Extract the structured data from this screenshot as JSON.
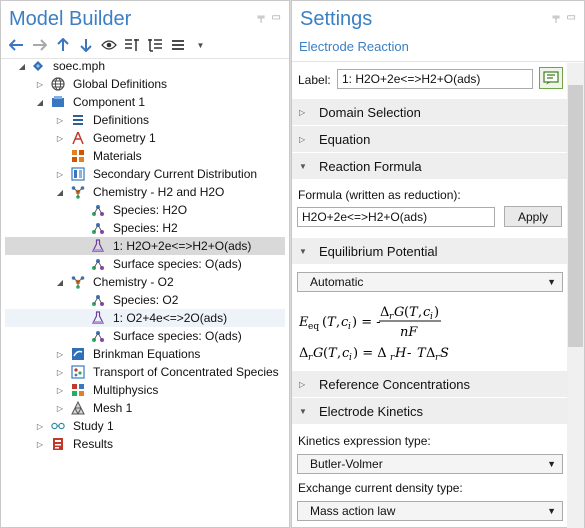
{
  "model_builder": {
    "title": "Model Builder",
    "tree": [
      {
        "label": "soec.mph",
        "icon": "model-file-icon",
        "arrow": "down"
      },
      {
        "label": "Global Definitions",
        "icon": "globe-icon",
        "arrow": "right"
      },
      {
        "label": "Component 1",
        "icon": "component-icon",
        "arrow": "down"
      },
      {
        "label": "Definitions",
        "icon": "definitions-list-icon",
        "arrow": "right"
      },
      {
        "label": "Geometry 1",
        "icon": "geometry-icon",
        "arrow": "right"
      },
      {
        "label": "Materials",
        "icon": "materials-icon",
        "arrow": ""
      },
      {
        "label": "Secondary Current Distribution",
        "icon": "current-distribution-icon",
        "arrow": "right"
      },
      {
        "label": "Chemistry - H2 and H2O",
        "icon": "chemistry-icon",
        "arrow": "down"
      },
      {
        "label": "Species: H2O",
        "icon": "species-icon",
        "arrow": ""
      },
      {
        "label": "Species: H2",
        "icon": "species-icon",
        "arrow": ""
      },
      {
        "label": "1: H2O+2e<=>H2+O(ads)",
        "icon": "flask-icon",
        "arrow": ""
      },
      {
        "label": "Surface species: O(ads)",
        "icon": "species-icon",
        "arrow": ""
      },
      {
        "label": "Chemistry - O2",
        "icon": "chemistry-icon",
        "arrow": "down"
      },
      {
        "label": "Species: O2",
        "icon": "species-icon",
        "arrow": ""
      },
      {
        "label": "1: O2+4e<=>2O(ads)",
        "icon": "flask-icon",
        "arrow": ""
      },
      {
        "label": "Surface species: O(ads)",
        "icon": "species-icon",
        "arrow": ""
      },
      {
        "label": "Brinkman Equations",
        "icon": "brinkman-icon",
        "arrow": "right"
      },
      {
        "label": "Transport of Concentrated Species",
        "icon": "transport-icon",
        "arrow": "right"
      },
      {
        "label": "Multiphysics",
        "icon": "multiphysics-icon",
        "arrow": "right"
      },
      {
        "label": "Mesh 1",
        "icon": "mesh-icon",
        "arrow": "right"
      },
      {
        "label": "Study 1",
        "icon": "study-icon",
        "arrow": "right"
      },
      {
        "label": "Results",
        "icon": "results-icon",
        "arrow": "right"
      }
    ]
  },
  "settings": {
    "title": "Settings",
    "subtitle": "Electrode Reaction",
    "label_caption": "Label:",
    "label_value": "1: H2O+2e<=>H2+O(ads)",
    "sections": {
      "domain_selection": "Domain Selection",
      "equation": "Equation",
      "reaction_formula": "Reaction Formula",
      "equilibrium_potential": "Equilibrium Potential",
      "reference_concentrations": "Reference Concentrations",
      "electrode_kinetics": "Electrode Kinetics"
    },
    "formula_caption": "Formula (written as reduction):",
    "formula_value": "H2O+2e<=>H2+O(ads)",
    "apply_label": "Apply",
    "equilibrium_select": "Automatic",
    "kinetics_caption": "Kinetics expression type:",
    "kinetics_select": "Butler-Volmer",
    "exchange_caption": "Exchange current density type:",
    "exchange_select": "Mass action law"
  }
}
